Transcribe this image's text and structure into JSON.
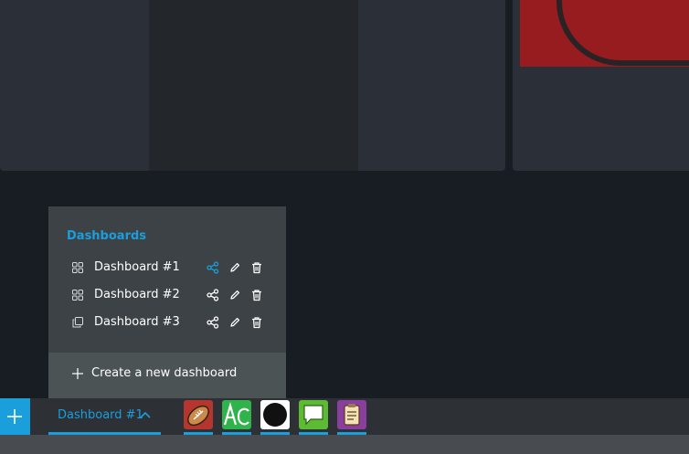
{
  "dashboards_menu": {
    "title": "Dashboards",
    "items": [
      {
        "label": "Dashboard #1",
        "icon": "grid-icon",
        "share_active": true
      },
      {
        "label": "Dashboard #2",
        "icon": "grid-icon",
        "share_active": false
      },
      {
        "label": "Dashboard #3",
        "icon": "copy-icon",
        "share_active": false
      }
    ],
    "create_label": "Create a new dashboard"
  },
  "taskbar": {
    "active_dashboard": "Dashboard #1",
    "apps": [
      {
        "name": "football-app-icon",
        "bg": "#b5362f"
      },
      {
        "name": "text-ac-app-icon",
        "bg": "#2fb34a"
      },
      {
        "name": "dark-circle-app-icon",
        "bg": "#ffffff"
      },
      {
        "name": "chat-app-icon",
        "bg": "#5dbb33"
      },
      {
        "name": "clipboard-app-icon",
        "bg": "#8a3f9e"
      }
    ]
  },
  "colors": {
    "accent": "#1a9fdc",
    "background": "#181d24",
    "menu_bg": "#3d4246",
    "menu_footer_bg": "#4c5355",
    "taskbar_bg": "#2d3136"
  }
}
